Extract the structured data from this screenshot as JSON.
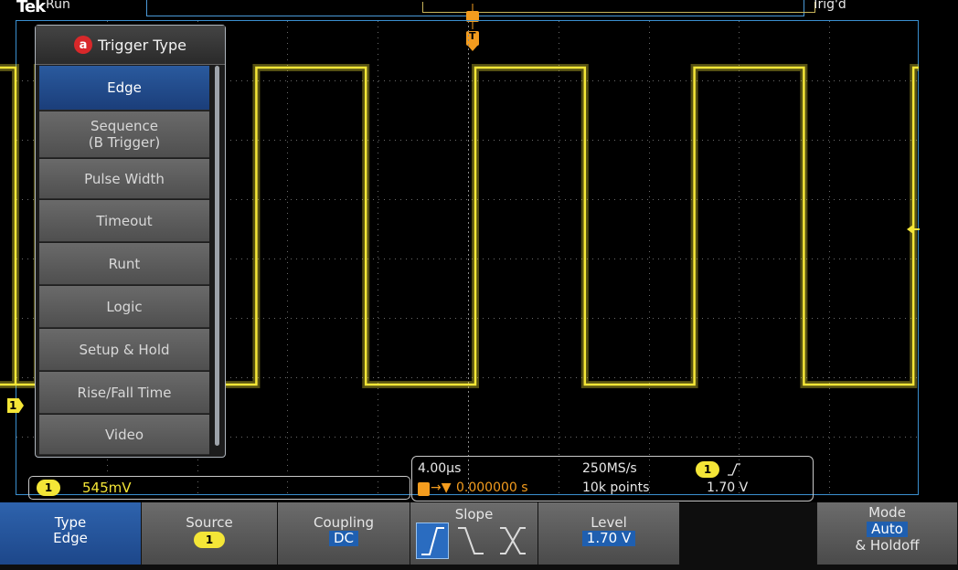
{
  "top": {
    "logo": "Tek",
    "acq_status": "Run",
    "trigger_status": "Trig'd"
  },
  "trigger_menu": {
    "title": "Trigger Type",
    "badge": "a",
    "items": [
      "Edge",
      "Sequence\n(B Trigger)",
      "Pulse Width",
      "Timeout",
      "Runt",
      "Logic",
      "Setup & Hold",
      "Rise/Fall Time",
      "Video"
    ],
    "selected": "Edge"
  },
  "markers": {
    "trigger_position": "T",
    "channel": "1"
  },
  "channel_readout": {
    "channel": "1",
    "scale": "545mV"
  },
  "timebase_readout": {
    "horizontal_scale": "4.00µs",
    "sample_rate": "250MS/s",
    "trigger_channel": "1",
    "delay_prefix": "→▼",
    "delay": "0.000000 s",
    "record_length": "10k points",
    "trigger_level": "1.70 V"
  },
  "buttons": {
    "type": {
      "label": "Type",
      "value": "Edge"
    },
    "source": {
      "label": "Source",
      "value": "1"
    },
    "coupling": {
      "label": "Coupling",
      "value": "DC"
    },
    "slope": {
      "label": "Slope",
      "options": [
        "rising",
        "falling",
        "either"
      ],
      "selected": "rising"
    },
    "level": {
      "label": "Level",
      "value": "1.70 V"
    },
    "mode": {
      "label": "Mode",
      "value": "Auto",
      "suffix": "& Holdoff"
    }
  },
  "waveform": {
    "channel": "1",
    "color": "#f4e637",
    "type": "square",
    "period_us": 9.7,
    "duty_cycle": 0.5
  },
  "colors": {
    "trace": "#f4e637",
    "graticule_border": "#3a8fcf",
    "menu_selected": "#1f4f95",
    "button_active": "#2a5aa0"
  }
}
